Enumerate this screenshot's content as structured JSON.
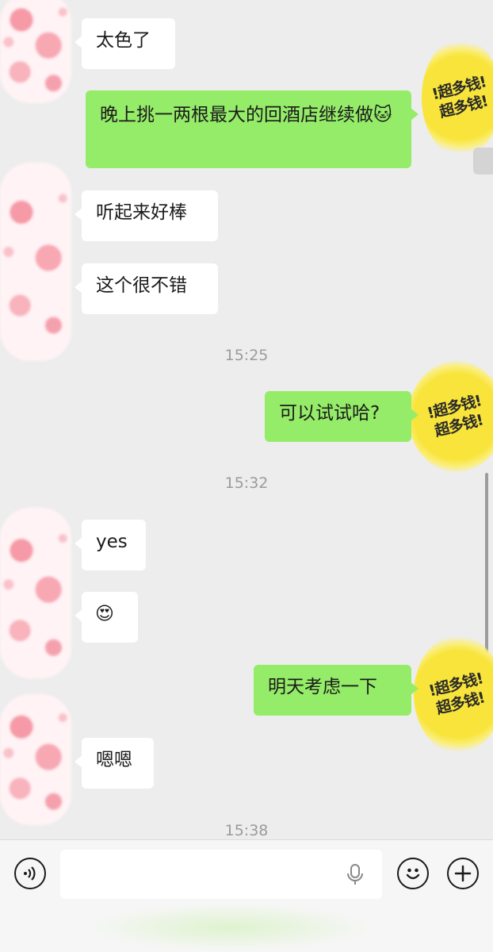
{
  "messages": {
    "m1": "太色了",
    "m2": "晚上挑一两根最大的回酒店继续做",
    "m2_emoji": "🐱",
    "m3": "听起来好棒",
    "m4": "这个很不错",
    "t1": "15:25",
    "m5": "可以试试哈?",
    "t2": "15:32",
    "m6": "yes",
    "m7_emoji": "😍",
    "m8": "明天考虑一下",
    "m9": "嗯嗯",
    "t3": "15:38"
  },
  "self_avatar": {
    "text": "!超多钱!超多钱!"
  },
  "input": {
    "placeholder": ""
  },
  "icons": {
    "voice": "voice-icon",
    "mic": "microphone-icon",
    "emoji": "emoji-icon",
    "plus": "plus-icon"
  },
  "colors": {
    "outgoing_bubble": "#95ec69",
    "incoming_bubble": "#ffffff",
    "background": "#ededed"
  }
}
